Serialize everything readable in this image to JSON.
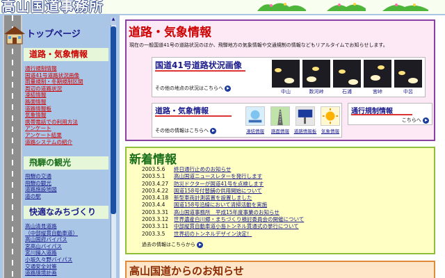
{
  "banner": {
    "logo_text": "高山国道事務所"
  },
  "sidebar": {
    "top_page": "トップページ",
    "road_weather_heading": "道路・気象情報",
    "road_weather_links": [
      "通行規制情報",
      "国道41号道路状況画像",
      "雨量規制・冬期規制区間",
      "周辺の道路状況",
      "凍結情報",
      "路面情報",
      "道路情報板",
      "気象情報",
      "携帯電話での利用方法",
      "アンケート",
      "アンケート結果",
      "道路システムの紹介"
    ],
    "hida_heading": "飛騨の観光",
    "hida_links": [
      "飛騨の交通",
      "飛騨の観光",
      "道路施設地図",
      "道の駅"
    ],
    "michizukuri_heading": "快適なみちづくり",
    "michizukuri_links": [
      "高山清見道路",
      "（中部縦貫自動車道）",
      "高山国府バイパス",
      "宮高山バイパス",
      "宮川揚入道路",
      "小坂久々野バイパス",
      "交通安全対策",
      "道路環境計画"
    ]
  },
  "road_panel": {
    "title": "道路・気象情報",
    "description": "現在の一般国道41号の道路状況のほか、飛騨地方の気象情報や交通規制の情報などもリアルタイムでお知らせします。",
    "camera_section": {
      "title": "国道41号道路状況画像",
      "other_text": "その他の地点の状況はこちらへ",
      "cameras": [
        "中山",
        "数河峠",
        "石浦",
        "宮峠",
        "中呂"
      ]
    },
    "weather_section": {
      "title": "道路・気象情報",
      "other_text": "その他の情報はこちらへ",
      "icons": [
        "凍結情報",
        "路面情報",
        "道路情報板",
        "気象情報"
      ]
    },
    "regulation_section": {
      "title": "通行規制情報",
      "more_text": "こちらへ"
    }
  },
  "news_panel": {
    "title": "新着情報",
    "items": [
      {
        "date": "2003.5.6",
        "text": "終日通行止めのお知らせ"
      },
      {
        "date": "2003.5.1",
        "text": "高山国道ニュースレターを発行します"
      },
      {
        "date": "2003.4.27",
        "text": "防災ドクターが国道41号を点検します"
      },
      {
        "date": "2003.4.22",
        "text": "国道158号付替舗の供用開始について"
      },
      {
        "date": "2003.4.18",
        "text": "新型車両計測装置を設置しました"
      },
      {
        "date": "2003.4.4",
        "text": "国道158号沿線において清掃活動を実施"
      },
      {
        "date": "2003.3.31",
        "text": "高山国道事務所　平成15年度事業のお知らせ"
      },
      {
        "date": "2003.3.12",
        "text": "世界遺産白川郷・まちづくり検討委員会の開催について"
      },
      {
        "date": "2003.3.11",
        "text": "中部縦貫自動車道小島トンネル貫通式の挙行について"
      },
      {
        "date": "2003.3.5",
        "text": "世界初のトンネルデザイン決定！"
      }
    ],
    "more_text": "過去の情報はこちらから"
  },
  "notice_panel": {
    "title": "高山国道からのお知らせ"
  }
}
